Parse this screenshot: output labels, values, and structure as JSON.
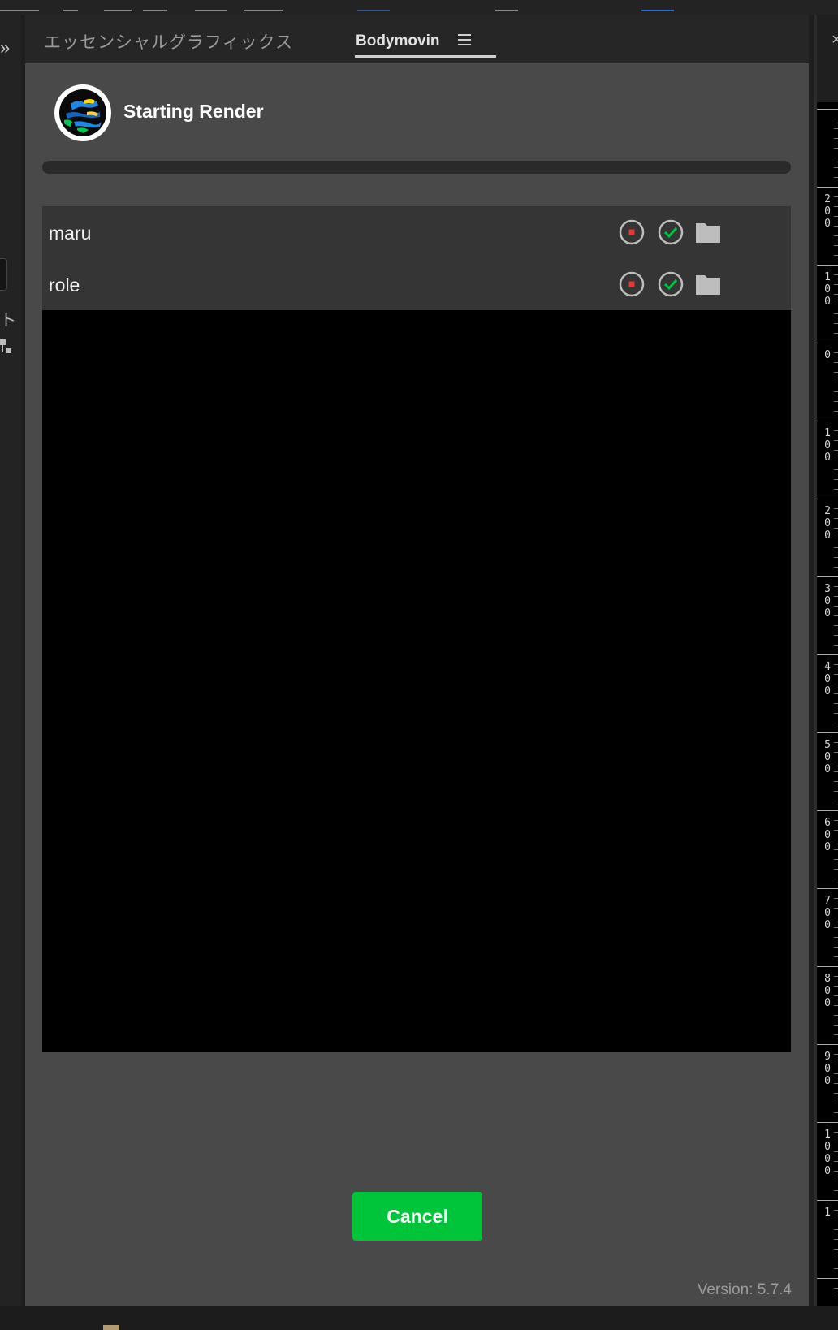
{
  "tabs": [
    {
      "label": "エッセンシャルグラフィックス",
      "active": false
    },
    {
      "label": "Bodymovin",
      "active": true
    }
  ],
  "header": {
    "title": "Starting Render",
    "logo_icon": "bodymovin-logo-icon"
  },
  "progress": {
    "value_percent": 0
  },
  "compositions": [
    {
      "name": "maru",
      "icons": [
        "stop-record-icon",
        "check-circle-icon",
        "folder-icon"
      ]
    },
    {
      "name": "role",
      "icons": [
        "stop-record-icon",
        "check-circle-icon",
        "folder-icon"
      ]
    }
  ],
  "actions": {
    "cancel_label": "Cancel"
  },
  "version_text": "Version: 5.7.4",
  "ruler_labels": [
    "200",
    "100",
    "0",
    "100",
    "200",
    "300",
    "400",
    "500",
    "600",
    "700",
    "800",
    "900",
    "1000",
    "1"
  ],
  "colors": {
    "accent_green": "#00c43a",
    "stop_red": "#e53935",
    "panel_bg": "#494949",
    "row_bg": "#353535"
  }
}
